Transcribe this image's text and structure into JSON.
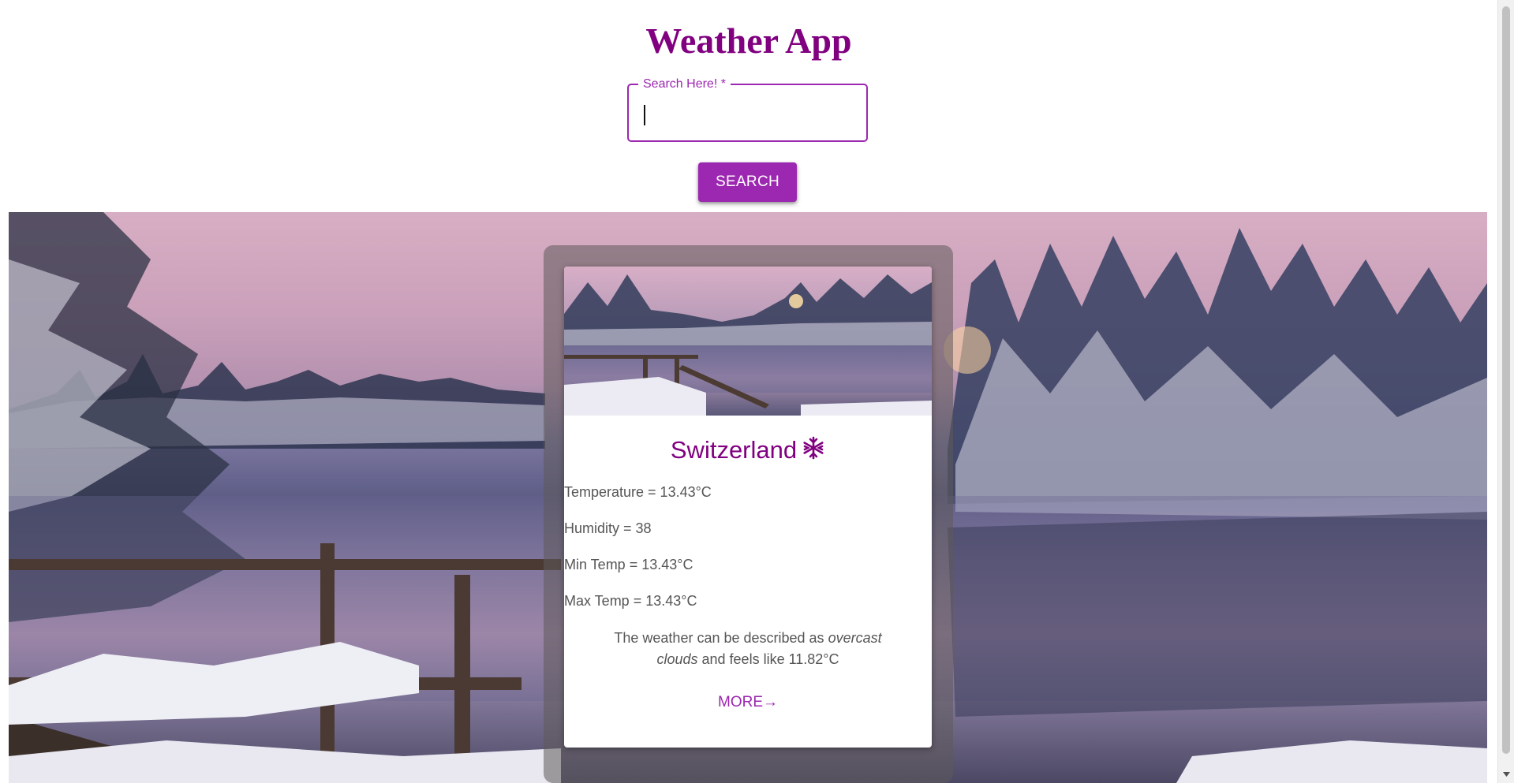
{
  "header": {
    "title": "Weather App"
  },
  "search": {
    "label": "Search Here! *",
    "value": "",
    "button_label": "SEARCH"
  },
  "card": {
    "city": "Switzerland",
    "condition_icon": "snowflake-icon",
    "temperature": "Temperature = 13.43°C",
    "humidity": "Humidity = 38",
    "min_temp": "Min Temp = 13.43°C",
    "max_temp": "Max Temp = 13.43°C",
    "description_prefix": "The weather can be described as ",
    "description_condition": "overcast clouds",
    "description_suffix": " and feels like 11.82°C",
    "more_label": "MORE→"
  },
  "colors": {
    "accent": "#9c27b0",
    "title": "#800080",
    "text": "#555555"
  }
}
